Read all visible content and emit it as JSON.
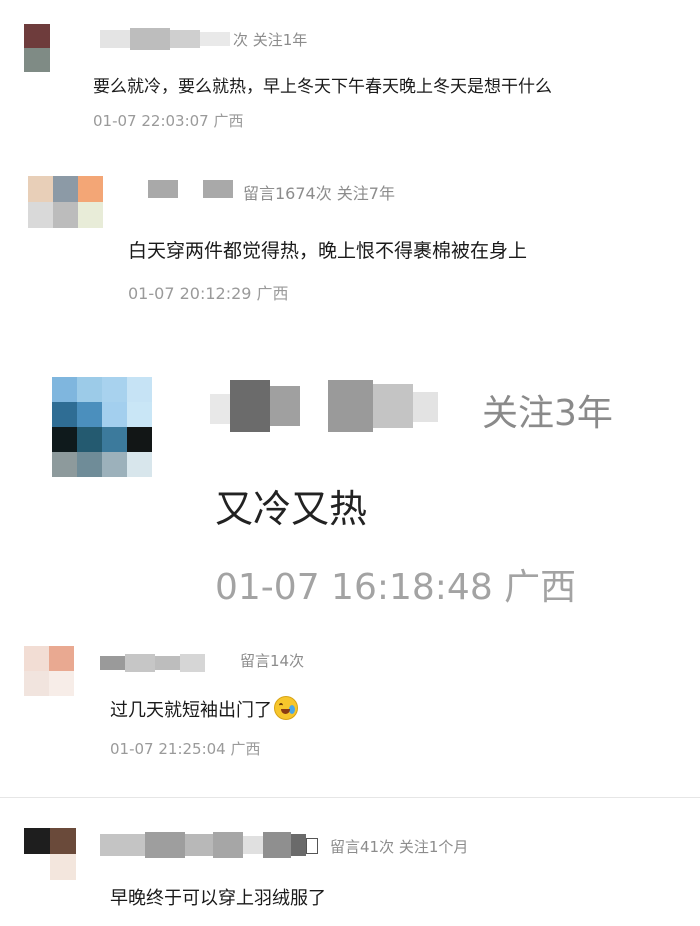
{
  "comments": [
    {
      "meta": "次 关注1年",
      "text": "要么就冷，要么就热，早上冬天下午春天晚上冬天是想干什么",
      "time": "01-07 22:03:07 广西"
    },
    {
      "meta": "留言1674次 关注7年",
      "text": "白天穿两件都觉得热，晚上恨不得裹棉被在身上",
      "time": "01-07 20:12:29 广西"
    },
    {
      "meta": "关注3年",
      "text": "又冷又热",
      "time": "01-07 16:18:48 广西"
    },
    {
      "meta": "留言14次",
      "text": "过几天就短袖出门了",
      "emoji": "crying-laughing-emoji",
      "time": "01-07 21:25:04 广西"
    },
    {
      "meta": "留言41次 关注1个月",
      "text": "早晚终于可以穿上羽绒服了"
    }
  ]
}
